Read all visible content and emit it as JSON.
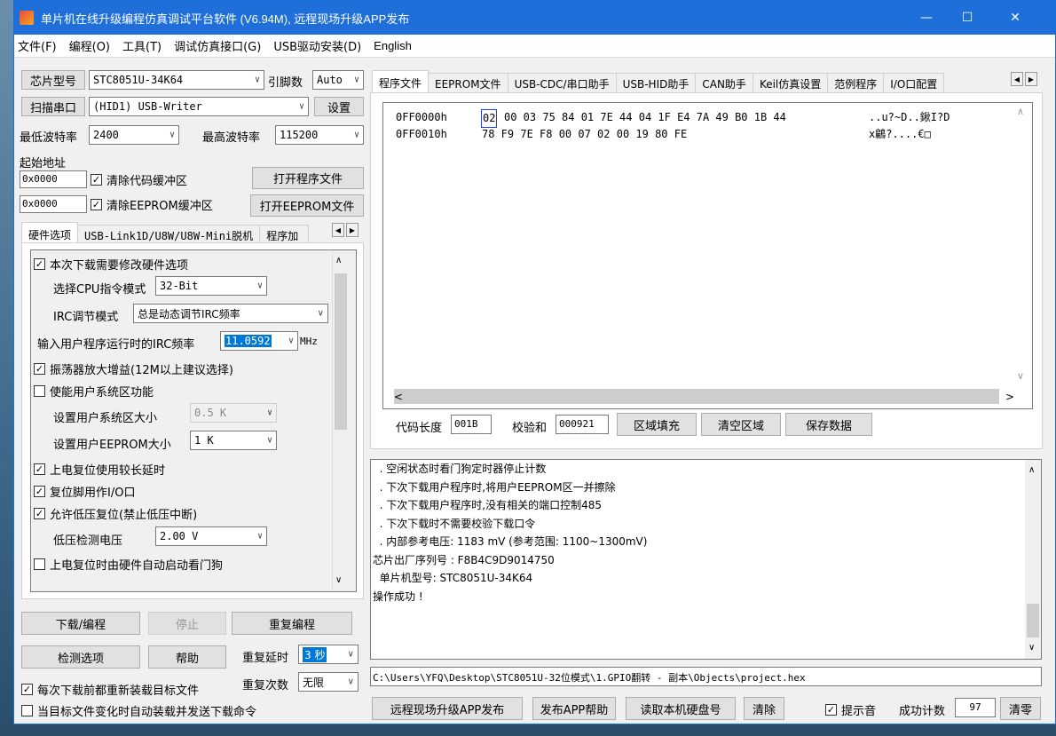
{
  "window": {
    "title": "单片机在线升级编程仿真调试平台软件 (V6.94M), 远程现场升级APP发布",
    "minimize": "—",
    "maximize": "☐",
    "close": "✕"
  },
  "menu": [
    "文件(F)",
    "编程(O)",
    "工具(T)",
    "调试仿真接口(G)",
    "USB驱动安装(D)",
    "English"
  ],
  "left": {
    "chip_label": "芯片型号",
    "chip_value": "STC8051U-34K64",
    "pins_label": "引脚数",
    "pins_value": "Auto",
    "scan_label": "扫描串口",
    "port_value": "(HID1) USB-Writer",
    "settings_label": "设置",
    "min_baud_label": "最低波特率",
    "min_baud": "2400",
    "max_baud_label": "最高波特率",
    "max_baud": "115200",
    "start_addr_label": "起始地址",
    "addr1": "0x0000",
    "clear_code": "清除代码缓冲区",
    "open_prog": "打开程序文件",
    "addr2": "0x0000",
    "clear_eeprom": "清除EEPROM缓冲区",
    "open_eeprom": "打开EEPROM文件",
    "tabs": [
      "硬件选项",
      "USB-Link1D/U8W/U8W-Mini脱机",
      "程序加"
    ],
    "hw": {
      "modify": "本次下载需要修改硬件选项",
      "cpu_mode_label": "选择CPU指令模式",
      "cpu_mode": "32-Bit",
      "irc_mode_label": "IRC调节模式",
      "irc_mode": "总是动态调节IRC频率",
      "irc_freq_label": "输入用户程序运行时的IRC频率",
      "irc_freq": "11.0592",
      "mhz": "MHz",
      "osc_gain": "振荡器放大增益(12M以上建议选择)",
      "user_sys": "使能用户系统区功能",
      "sys_size_label": "设置用户系统区大小",
      "sys_size": "0.5 K",
      "eeprom_size_label": "设置用户EEPROM大小",
      "eeprom_size": "1   K",
      "long_delay": "上电复位使用较长延时",
      "reset_io": "复位脚用作I/O口",
      "low_volt_reset": "允许低压复位(禁止低压中断)",
      "low_volt_label": "低压检测电压",
      "low_volt": "2.00 V",
      "watchdog": "上电复位时由硬件自动启动看门狗"
    },
    "download": "下载/编程",
    "stop": "停止",
    "repeat_prog": "重复编程",
    "check_opt": "检测选项",
    "help": "帮助",
    "repeat_delay_label": "重复延时",
    "repeat_delay": "3 秒",
    "repeat_count_label": "重复次数",
    "repeat_count": "无限",
    "reload": "每次下载前都重新装载目标文件",
    "auto_reload": "当目标文件变化时自动装载并发送下载命令"
  },
  "right": {
    "tabs": [
      "程序文件",
      "EEPROM文件",
      "USB-CDC/串口助手",
      "USB-HID助手",
      "CAN助手",
      "Keil仿真设置",
      "范例程序",
      "I/O口配置"
    ],
    "hex": [
      {
        "addr": "0FF0000h",
        "first": "02",
        "bytes": "00 03 75 84 01 7E 44 04 1F E4 7A 49 B0 1B 44",
        "ascii": "..u?~D..鍬I?D"
      },
      {
        "addr": "0FF0010h",
        "first": "",
        "bytes": "78 F9 7E F8 00 07 02 00 19 80 FE",
        "ascii": "x鶣?....€□"
      }
    ],
    "code_len_label": "代码长度",
    "code_len": "001B",
    "checksum_label": "校验和",
    "checksum": "000921",
    "fill": "区域填充",
    "clear_area": "清空区域",
    "save": "保存数据",
    "log": [
      "  . 空闲状态时看门狗定时器停止计数",
      "  . 下次下载用户程序时,将用户EEPROM区一并擦除",
      "  . 下次下载用户程序时,没有相关的端口控制485",
      "  . 下次下载时不需要校验下载口令",
      "  . 内部参考电压: 1183 mV (参考范围: 1100~1300mV)",
      "芯片出厂序列号 : F8B4C9D9014750",
      "",
      "  单片机型号: STC8051U-34K64",
      "",
      "操作成功 !"
    ],
    "path": "C:\\Users\\YFQ\\Desktop\\STC8051U-32位模式\\1.GPIO翻转 - 副本\\Objects\\project.hex",
    "remote": "远程现场升级APP发布",
    "publish": "发布APP帮助",
    "read_disk": "读取本机硬盘号",
    "clear": "清除",
    "sound": "提示音",
    "success_label": "成功计数",
    "success_count": "97",
    "reset_count": "清零"
  }
}
